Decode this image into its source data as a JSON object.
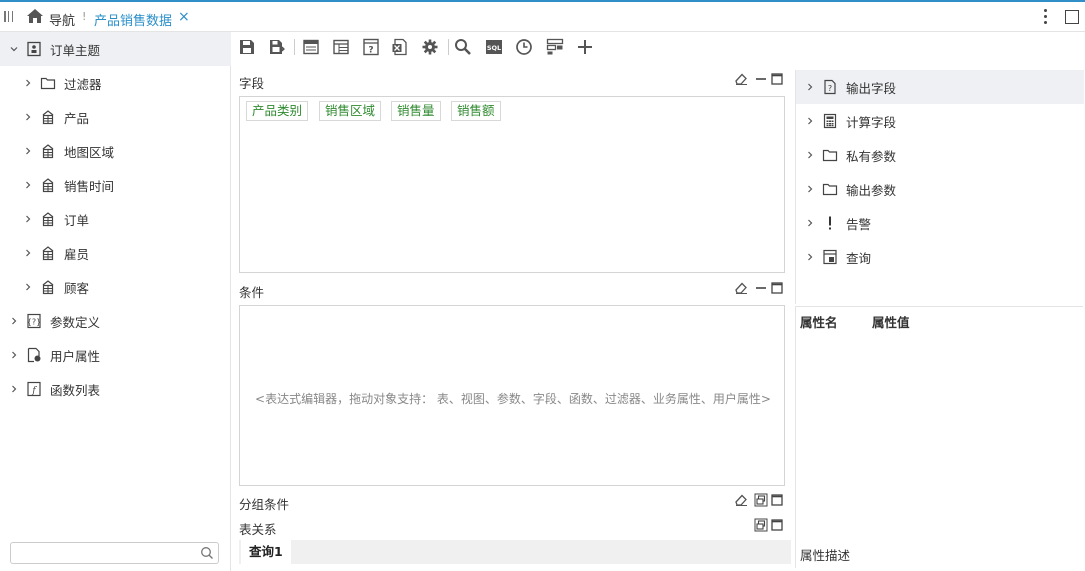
{
  "top_bar": {
    "nav_label": "导航",
    "separator": "!",
    "tab_label": "产品销售数据",
    "close": "×"
  },
  "left_tree": {
    "root": {
      "label": "订单主题",
      "icon": "subject-icon"
    },
    "children": [
      {
        "label": "过滤器",
        "icon": "folder-icon"
      },
      {
        "label": "产品",
        "icon": "table-icon"
      },
      {
        "label": "地图区域",
        "icon": "table-icon"
      },
      {
        "label": "销售时间",
        "icon": "table-icon"
      },
      {
        "label": "订单",
        "icon": "table-icon"
      },
      {
        "label": "雇员",
        "icon": "table-icon"
      },
      {
        "label": "顾客",
        "icon": "table-icon"
      }
    ],
    "others": [
      {
        "label": "参数定义",
        "icon": "param-definition-icon"
      },
      {
        "label": "用户属性",
        "icon": "user-attribute-icon"
      },
      {
        "label": "函数列表",
        "icon": "function-list-icon"
      }
    ],
    "search_placeholder": ""
  },
  "toolbar": {
    "icons": [
      "save-icon",
      "save-as-icon",
      "data-source-icon",
      "table-layout-icon",
      "help-doc-icon",
      "export-excel-icon",
      "settings-gear-icon",
      "search-icon",
      "sql-icon",
      "clock-icon",
      "schema-icon",
      "add-icon"
    ],
    "sql_text": "SQL"
  },
  "fields_section": {
    "title": "字段",
    "chips": [
      "产品类别",
      "销售区域",
      "销售量",
      "销售额"
    ]
  },
  "condition_section": {
    "title": "条件",
    "placeholder": "<表达式编辑器，拖动对象支持： 表、视图、参数、字段、函数、过滤器、业务属性、用户属性>"
  },
  "group_section": {
    "title": "分组条件"
  },
  "relation_section": {
    "title": "表关系",
    "query_tab": "查询1"
  },
  "right_tree": [
    {
      "label": "输出字段",
      "icon": "output-field-icon"
    },
    {
      "label": "计算字段",
      "icon": "calculator-icon"
    },
    {
      "label": "私有参数",
      "icon": "folder-icon"
    },
    {
      "label": "输出参数",
      "icon": "folder-icon"
    },
    {
      "label": "告警",
      "icon": "exclamation-icon"
    },
    {
      "label": "查询",
      "icon": "query-icon"
    }
  ],
  "properties": {
    "name_header": "属性名",
    "value_header": "属性值",
    "description_label": "属性描述"
  },
  "colors": {
    "accent": "#2a8fc9",
    "chip_text": "#2f8a2f",
    "selected_bg": "#eef0f3"
  }
}
